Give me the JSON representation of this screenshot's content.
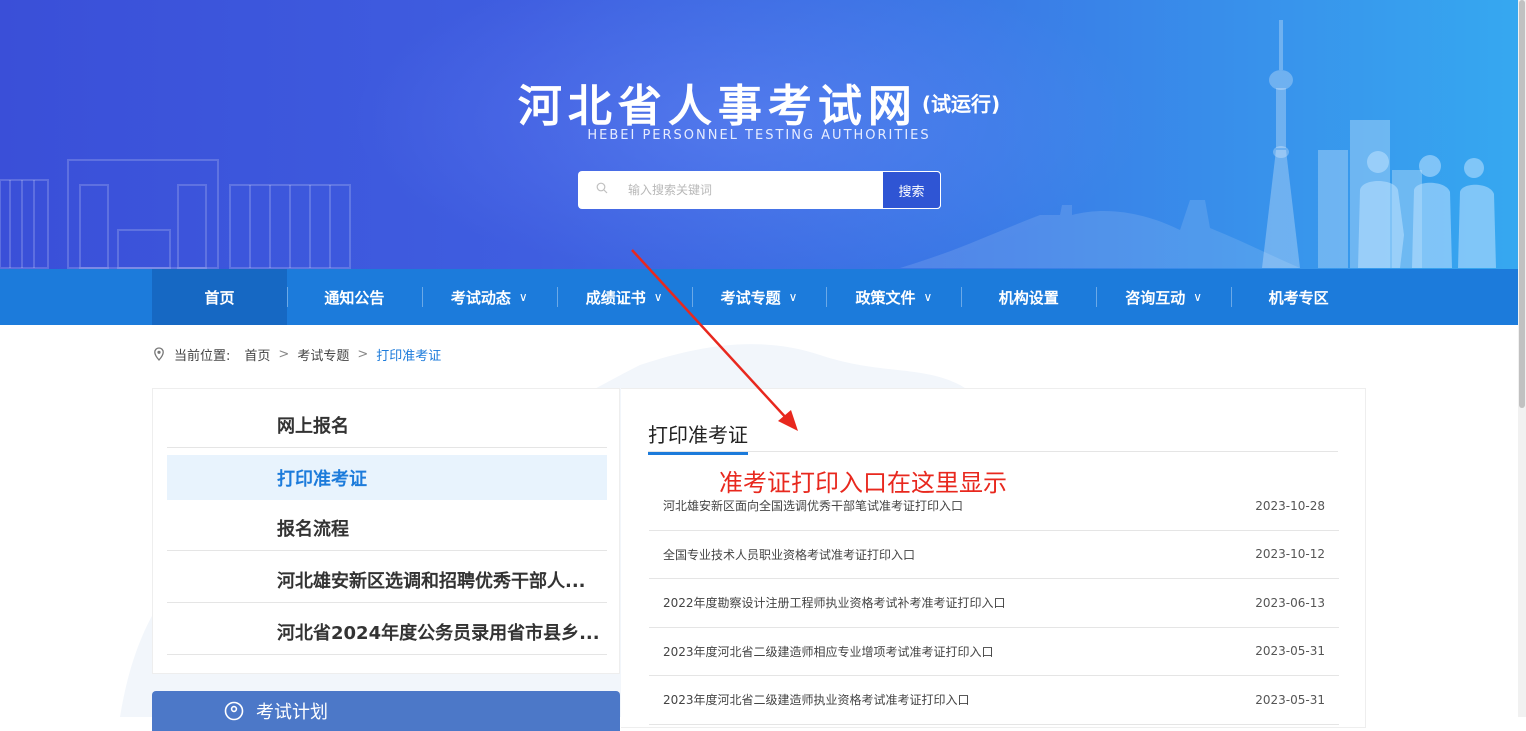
{
  "header": {
    "title": "河北省人事考试网",
    "title_suffix": "(试运行)",
    "subtitle": "HEBEI PERSONNEL TESTING AUTHORITIES",
    "search": {
      "placeholder": "输入搜索关键词",
      "button_label": "搜索"
    }
  },
  "nav": {
    "items": [
      {
        "label": "首页",
        "active": true,
        "dropdown": false
      },
      {
        "label": "通知公告",
        "dropdown": false
      },
      {
        "label": "考试动态",
        "dropdown": true
      },
      {
        "label": "成绩证书",
        "dropdown": true
      },
      {
        "label": "考试专题",
        "dropdown": true
      },
      {
        "label": "政策文件",
        "dropdown": true
      },
      {
        "label": "机构设置",
        "dropdown": false
      },
      {
        "label": "咨询互动",
        "dropdown": true
      },
      {
        "label": "机考专区",
        "dropdown": false
      }
    ],
    "chevron": "∨"
  },
  "breadcrumb": {
    "prefix": "当前位置:",
    "items": [
      "首页",
      "考试专题",
      "打印准考证"
    ],
    "separator": ">"
  },
  "sidebar": {
    "items": [
      {
        "label": "网上报名"
      },
      {
        "label": "打印准考证",
        "active": true
      },
      {
        "label": "报名流程"
      },
      {
        "label": "河北雄安新区选调和招聘优秀干部人..."
      },
      {
        "label": "河北省2024年度公务员录用省市县乡..."
      }
    ],
    "plan_label": "考试计划"
  },
  "content": {
    "title": "打印准考证",
    "annotation": "准考证打印入口在这里显示",
    "articles": [
      {
        "title": "河北雄安新区面向全国选调优秀干部笔试准考证打印入口",
        "date": "2023-10-28"
      },
      {
        "title": "全国专业技术人员职业资格考试准考证打印入口",
        "date": "2023-10-12"
      },
      {
        "title": "2022年度勘察设计注册工程师执业资格考试补考准考证打印入口",
        "date": "2023-06-13"
      },
      {
        "title": "2023年度河北省二级建造师相应专业增项考试准考证打印入口",
        "date": "2023-05-31"
      },
      {
        "title": "2023年度河北省二级建造师执业资格考试准考证打印入口",
        "date": "2023-05-31"
      }
    ]
  },
  "colors": {
    "nav_bg": "#1c7bdb",
    "nav_active": "#1668c3",
    "accent": "#1c7bdb",
    "annotation": "#e8281e",
    "plan_bar": "#4c78c8"
  },
  "icons": {
    "search": "search-icon",
    "location": "location-pin-icon",
    "plan": "location-pin-icon"
  }
}
